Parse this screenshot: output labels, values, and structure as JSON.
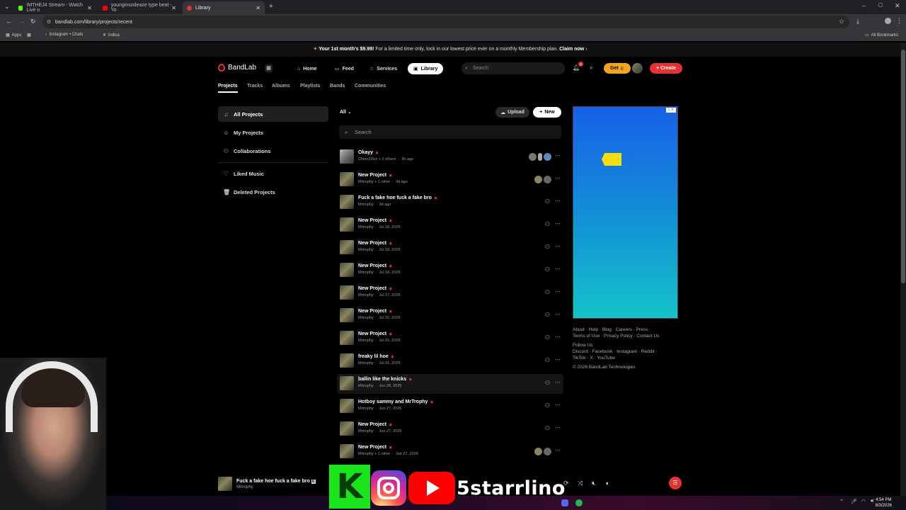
{
  "browser": {
    "tabs": [
      {
        "title": "IMTHEJ4 Stream - Watch Live o",
        "color": "#53fc18"
      },
      {
        "title": "younginsodeaze type beat - Yo",
        "color": "#ff0000"
      },
      {
        "title": "Library",
        "color": "#e63232"
      }
    ],
    "url": "bandlab.com/library/projects/recent",
    "bookmarks": [
      "Apps",
      "Instagram • Chats",
      "indica"
    ],
    "all_bookmarks": "All Bookmarks"
  },
  "promo": {
    "bold": "Your 1st month's $9.99!",
    "text": " For a limited time only, lock in our lowest price ever on a monthly Membership plan. ",
    "cta": "Claim now"
  },
  "header": {
    "logo": "BandLab",
    "nav": [
      "Home",
      "Feed",
      "Services",
      "Library"
    ],
    "search_placeholder": "Search",
    "notification_count": "3",
    "get_label": "Get",
    "create_label": "+ Create"
  },
  "subtabs": [
    "Projects",
    "Tracks",
    "Albums",
    "Playlists",
    "Bands",
    "Communities"
  ],
  "sidebar": {
    "items": [
      {
        "label": "All Projects",
        "icon": "music-note-icon"
      },
      {
        "label": "My Projects",
        "icon": "user-icon"
      },
      {
        "label": "Collaborations",
        "icon": "users-icon"
      },
      {
        "label": "Liked Music",
        "icon": "heart-icon"
      },
      {
        "label": "Deleted Projects",
        "icon": "trash-icon"
      }
    ]
  },
  "list": {
    "filter": "All",
    "upload_label": "Upload",
    "new_label": "New",
    "search_placeholder": "Search",
    "rows": [
      {
        "title": "Okayy",
        "artist": "Chino23lzz + 2 others",
        "date": "2h ago"
      },
      {
        "title": "New Project",
        "artist": "Mrtrophy + 1 other",
        "date": "3d ago"
      },
      {
        "title": "Fuck a fake hoe fuck a fake bro",
        "artist": "Mrtrophy",
        "date": "3d ago"
      },
      {
        "title": "New Project",
        "artist": "Mrtrophy",
        "date": "Jul 18, 2026"
      },
      {
        "title": "New Project",
        "artist": "Mrtrophy",
        "date": "Jul 18, 2026"
      },
      {
        "title": "New Project",
        "artist": "Mrtrophy",
        "date": "Jul 18, 2026"
      },
      {
        "title": "New Project",
        "artist": "Mrtrophy",
        "date": "Jul 17, 2026"
      },
      {
        "title": "New Project",
        "artist": "Mrtrophy",
        "date": "Jul 10, 2026"
      },
      {
        "title": "New Project",
        "artist": "Mrtrophy",
        "date": "Jul 01, 2026"
      },
      {
        "title": "freaky lil hoe",
        "artist": "Mrtrophy",
        "date": "Jul 01, 2026"
      },
      {
        "title": "ballin like the knicks",
        "artist": "Mrtrophy",
        "date": "Jun 28, 2026"
      },
      {
        "title": "Hotboy sammy and MrTrophy",
        "artist": "Mrtrophy",
        "date": "Jun 27, 2026"
      },
      {
        "title": "New Project",
        "artist": "Mrtrophy",
        "date": "Jun 27, 2026"
      },
      {
        "title": "New Project",
        "artist": "Mrtrophy + 1 other",
        "date": "Jun 27, 2026"
      }
    ]
  },
  "footer": {
    "line1": "About · Help · Blog · Careers · Press ·",
    "line2": "Terms of Use · Privacy Policy · Contact Us",
    "line3": "Follow Us",
    "line4": "Discord · Facebook · Instagram · Reddit ·",
    "line5": "TikTok · X · YouTube",
    "line6": "© 2026 BandLab Technologies"
  },
  "player": {
    "title": "Fuck a fake hoe fuck a fake bro",
    "artist": "Mrtrophy"
  },
  "overlay": {
    "handle": "5starrlino"
  },
  "taskbar": {
    "time": "4:54 PM",
    "date": "8/3/2026"
  },
  "colors": {
    "brand": "#e63232",
    "get": "#f3a51c"
  }
}
